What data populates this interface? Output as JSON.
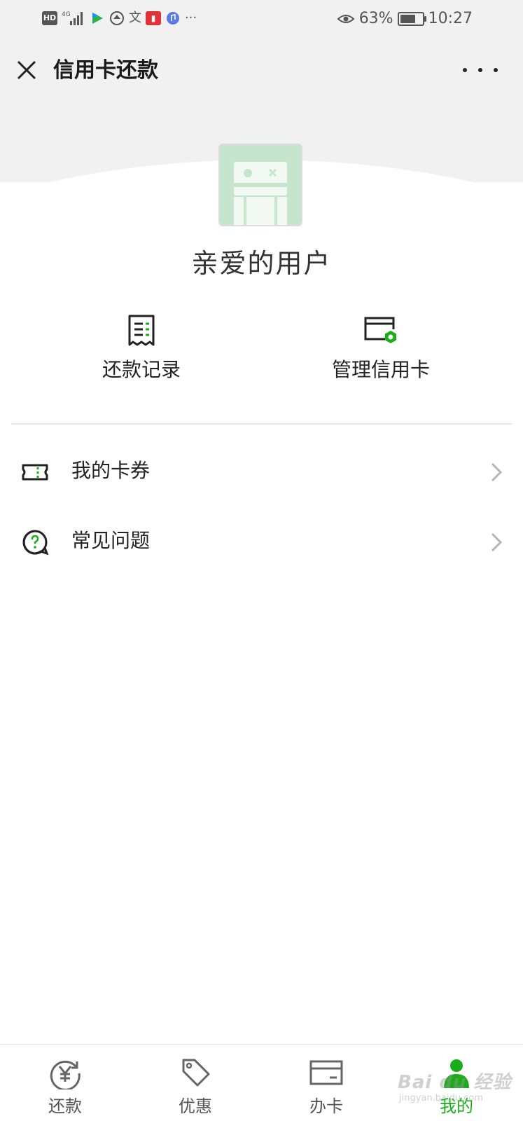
{
  "status_bar": {
    "network_left_icons": [
      "hd-icon",
      "4g-signal-icon",
      "video-app-icon",
      "hat-app-icon",
      "translate-app-icon",
      "book-app-icon",
      "music-app-icon"
    ],
    "more_glyph": "···",
    "battery_percent": "63%",
    "battery_level": 0.63,
    "time": "10:27"
  },
  "header": {
    "title": "信用卡还款"
  },
  "user": {
    "name": "亲爱的用户"
  },
  "actions": [
    {
      "label": "还款记录",
      "icon": "receipt-icon"
    },
    {
      "label": "管理信用卡",
      "icon": "card-settings-icon"
    }
  ],
  "menu": [
    {
      "label": "我的卡券",
      "icon": "coupon-icon"
    },
    {
      "label": "常见问题",
      "icon": "question-icon"
    }
  ],
  "bottom_nav": [
    {
      "label": "还款",
      "icon": "yen-refresh-icon",
      "active": false
    },
    {
      "label": "优惠",
      "icon": "tag-icon",
      "active": false
    },
    {
      "label": "办卡",
      "icon": "card-icon",
      "active": false
    },
    {
      "label": "我的",
      "icon": "person-icon",
      "active": true
    }
  ],
  "watermark": {
    "text": "Bai du 经验",
    "sub": "jingyan.baidu.com"
  },
  "colors": {
    "accent": "#1aad19",
    "avatar_bg": "#c6e5cd"
  }
}
